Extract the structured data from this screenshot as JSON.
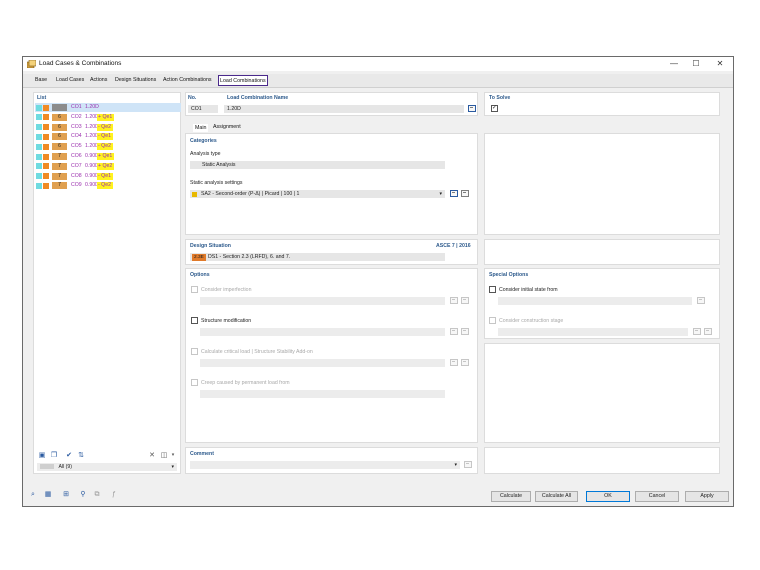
{
  "window": {
    "title": "Load Cases & Combinations",
    "controls": {
      "minimize": "—",
      "maximize": "☐",
      "close": "✕"
    }
  },
  "tabs": [
    "Base",
    "Load Cases",
    "Actions",
    "Design Situations",
    "Action Combinations",
    "Load Combinations"
  ],
  "active_tab": "Load Combinations",
  "list": {
    "header": "List",
    "items": [
      {
        "badge": "",
        "name": "CO1",
        "factor": "1.20D",
        "extra": "",
        "badge_color": "#8c8c8c",
        "selected": true
      },
      {
        "badge": "6",
        "name": "CO2",
        "factor": "1.20D",
        "extra": "+ Qe1",
        "badge_color": "#e0a050",
        "selected": false
      },
      {
        "badge": "6",
        "name": "CO3",
        "factor": "1.20D",
        "extra": "- Qe2",
        "badge_color": "#e0a050",
        "selected": false
      },
      {
        "badge": "6",
        "name": "CO4",
        "factor": "1.20D",
        "extra": "- Qe1",
        "badge_color": "#e0a050",
        "selected": false
      },
      {
        "badge": "6",
        "name": "CO5",
        "factor": "1.20D",
        "extra": "- Qe2",
        "badge_color": "#e0a050",
        "selected": false
      },
      {
        "badge": "7",
        "name": "CO6",
        "factor": "0.90D",
        "extra": "+ Qe1",
        "badge_color": "#e0a050",
        "selected": false
      },
      {
        "badge": "7",
        "name": "CO7",
        "factor": "0.90D",
        "extra": "+ Qe2",
        "badge_color": "#e0a050",
        "selected": false
      },
      {
        "badge": "7",
        "name": "CO8",
        "factor": "0.90D",
        "extra": "- Qe1",
        "badge_color": "#e0a050",
        "selected": false
      },
      {
        "badge": "7",
        "name": "CO9",
        "factor": "0.90D",
        "extra": "- Qe2",
        "badge_color": "#e0a050",
        "selected": false
      }
    ],
    "filter": "All (9)"
  },
  "header": {
    "no_label": "No.",
    "no_value": "CO1",
    "name_label": "Load Combination Name",
    "name_value": "1.20D",
    "to_solve_label": "To Solve"
  },
  "subtabs": [
    "Main",
    "Assignment"
  ],
  "categories": {
    "header": "Categories",
    "analysis_type_label": "Analysis type",
    "analysis_type_value": "Static Analysis",
    "static_settings_label": "Static analysis settings",
    "static_settings_value": "SA2 - Second-order (P-Δ) | Picard | 100 | 1"
  },
  "design_situation": {
    "header": "Design Situation",
    "standard": "ASCE 7 | 2016",
    "badge": "2.3E",
    "value": "DS1 - Section 2.3 (LRFD), 6. and 7."
  },
  "options": {
    "header": "Options",
    "consider_imperfection": "Consider imperfection",
    "structure_modification": "Structure modification",
    "calculate_critical_load": "Calculate critical load | Structure Stability Add-on",
    "creep": "Creep caused by permanent load from"
  },
  "special_options": {
    "header": "Special Options",
    "initial_state": "Consider initial state from",
    "construction_stage": "Consider construction stage"
  },
  "comment": {
    "header": "Comment"
  },
  "buttons": {
    "calculate": "Calculate",
    "calculate_all": "Calculate All",
    "ok": "OK",
    "cancel": "Cancel",
    "apply": "Apply"
  },
  "colors": {
    "accent_purple": "#4b2a8c",
    "heading_blue": "#2d5a8c",
    "combo_purple": "#9b2fae",
    "highlight_yellow": "#fff220",
    "badge_orange": "#e07a2a"
  }
}
